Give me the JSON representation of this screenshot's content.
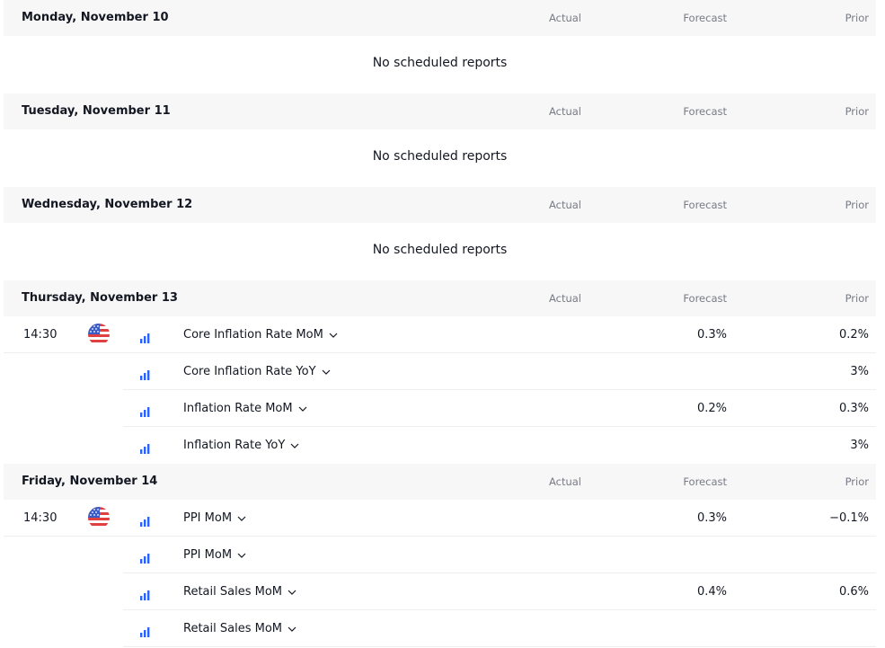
{
  "columns": {
    "actual": "Actual",
    "forecast": "Forecast",
    "prior": "Prior"
  },
  "empty_text": "No scheduled reports",
  "days": [
    {
      "title": "Monday, November 10"
    },
    {
      "title": "Tuesday, November 11"
    },
    {
      "title": "Wednesday, November 12"
    },
    {
      "title": "Thursday, November 13",
      "events": [
        {
          "time": "14:30",
          "name": "Core Inflation Rate MoM",
          "forecast": "0.3%",
          "prior": "0.2%"
        },
        {
          "time": "",
          "name": "Core Inflation Rate YoY",
          "forecast": "",
          "prior": "3%"
        },
        {
          "time": "",
          "name": "Inflation Rate MoM",
          "forecast": "0.2%",
          "prior": "0.3%"
        },
        {
          "time": "",
          "name": "Inflation Rate YoY",
          "forecast": "",
          "prior": "3%"
        }
      ]
    },
    {
      "title": "Friday, November 14",
      "events": [
        {
          "time": "14:30",
          "name": "PPI MoM",
          "forecast": "0.3%",
          "prior": "−0.1%"
        },
        {
          "time": "",
          "name": "PPI MoM",
          "forecast": "",
          "prior": ""
        },
        {
          "time": "",
          "name": "Retail Sales MoM",
          "forecast": "0.4%",
          "prior": "0.6%"
        },
        {
          "time": "",
          "name": "Retail Sales MoM",
          "forecast": "",
          "prior": ""
        }
      ]
    }
  ],
  "colors": {
    "header_bg": "#f7f7f7",
    "muted": "#787b86",
    "accent": "#2962ff"
  },
  "icons": {
    "flag": "us-flag-icon",
    "importance": "importance-bars-icon",
    "expand": "chevron-down-icon"
  }
}
